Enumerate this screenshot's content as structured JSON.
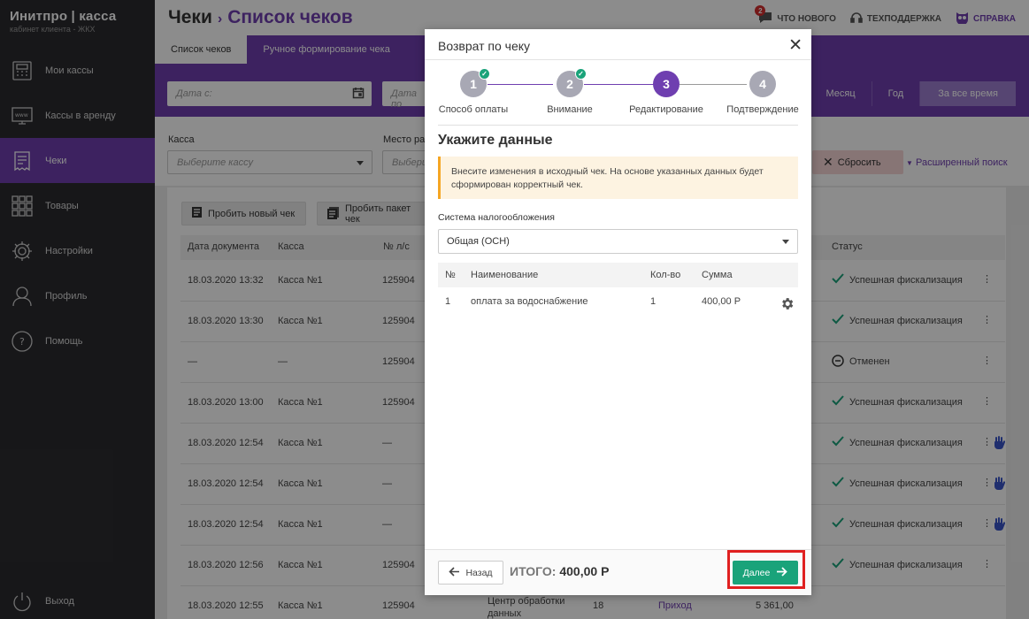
{
  "brand": {
    "name": "Инитпро | касса",
    "sub": "кабинет клиента - ЖКХ"
  },
  "sidebar": {
    "items": [
      {
        "label": "Мои кассы",
        "icon": "cash-register-icon"
      },
      {
        "label": "Кассы в аренду",
        "icon": "www-icon"
      },
      {
        "label": "Чеки",
        "icon": "receipt-icon"
      },
      {
        "label": "Товары",
        "icon": "grid-icon"
      },
      {
        "label": "Настройки",
        "icon": "gear-icon"
      },
      {
        "label": "Профиль",
        "icon": "user-icon"
      },
      {
        "label": "Помощь",
        "icon": "help-icon"
      }
    ],
    "logout": "Выход"
  },
  "header": {
    "title": "Чеки",
    "separator": "›",
    "current": "Список чеков",
    "links": {
      "whats_new": "ЧТО НОВОГО",
      "support": "ТЕХПОДДЕРЖКА",
      "help": "СПРАВКА"
    },
    "badge": "2"
  },
  "tabs": [
    "Список чеков",
    "Ручное формирование чека"
  ],
  "dates": {
    "from_placeholder": "Дата с:",
    "to_placeholder": "Дата по"
  },
  "period": [
    "Месяц",
    "Год",
    "За все время"
  ],
  "filters": {
    "kassa_label": "Касса",
    "kassa_placeholder": "Выберите кассу",
    "place_label": "Место рас",
    "place_placeholder": "Выбери",
    "reset": "Сбросить",
    "advanced": "Расширенный поиск"
  },
  "actions": {
    "new_check": "Пробить новый чек",
    "batch": "Пробить пакет чек"
  },
  "table": {
    "headers": [
      "Дата документа",
      "Касса",
      "№ л/с",
      "Статус"
    ],
    "rows": [
      {
        "date": "18.03.2020 13:32",
        "kassa": "Касса №1",
        "ls": "125904",
        "status": "Успешная фискализация",
        "status_icon": "check-icon",
        "hand": false
      },
      {
        "date": "18.03.2020 13:30",
        "kassa": "Касса №1",
        "ls": "125904",
        "status": "Успешная фискализация",
        "status_icon": "check-icon",
        "hand": false
      },
      {
        "date": "—",
        "kassa": "—",
        "ls": "125904",
        "status": "Отменен",
        "status_icon": "minus-circle-icon",
        "hand": false
      },
      {
        "date": "18.03.2020 13:00",
        "kassa": "Касса №1",
        "ls": "125904",
        "status": "Успешная фискализация",
        "status_icon": "check-icon",
        "hand": false
      },
      {
        "date": "18.03.2020 12:54",
        "kassa": "Касса №1",
        "ls": "—",
        "status": "Успешная фискализация",
        "status_icon": "check-icon",
        "hand": true
      },
      {
        "date": "18.03.2020 12:54",
        "kassa": "Касса №1",
        "ls": "—",
        "status": "Успешная фискализация",
        "status_icon": "check-icon",
        "hand": true
      },
      {
        "date": "18.03.2020 12:54",
        "kassa": "Касса №1",
        "ls": "—",
        "status": "Успешная фискализация",
        "status_icon": "check-icon",
        "hand": true
      },
      {
        "date": "18.03.2020 12:56",
        "kassa": "Касса №1",
        "ls": "125904",
        "status": "Успешная фискализация",
        "status_icon": "check-icon",
        "hand": false
      },
      {
        "date": "18.03.2020 12:55",
        "kassa": "Касса №1",
        "ls": "125904",
        "status": "",
        "status_icon": "",
        "hand": false,
        "place": "Центр обработки данных",
        "num": "18",
        "type": "Приход",
        "amount": "5 361,00"
      }
    ]
  },
  "modal": {
    "title": "Возврат по чеку",
    "steps": [
      {
        "num": "1",
        "label": "Способ оплаты",
        "done": true
      },
      {
        "num": "2",
        "label": "Внимание",
        "done": true
      },
      {
        "num": "3",
        "label": "Редактирование",
        "current": true
      },
      {
        "num": "4",
        "label": "Подтверждение"
      }
    ],
    "section_title": "Укажите данные",
    "notice": "Внесите изменения в исходный чек. На основе указанных данных будет сформирован корректный чек.",
    "tax_label": "Система налогообложения",
    "tax_value": "Общая (ОСН)",
    "items_headers": {
      "num": "№",
      "name": "Наименование",
      "qty": "Кол-во",
      "sum": "Сумма"
    },
    "items": [
      {
        "num": "1",
        "name": "оплата за водоснабжение",
        "qty": "1",
        "sum": "400,00 Р"
      }
    ],
    "back": "Назад",
    "total_label": "ИТОГО:",
    "total_value": "400,00 Р",
    "next": "Далее"
  },
  "colors": {
    "accent": "#6f3fb0",
    "success": "#1aa37a",
    "sidebar": "#2b2b2f"
  }
}
